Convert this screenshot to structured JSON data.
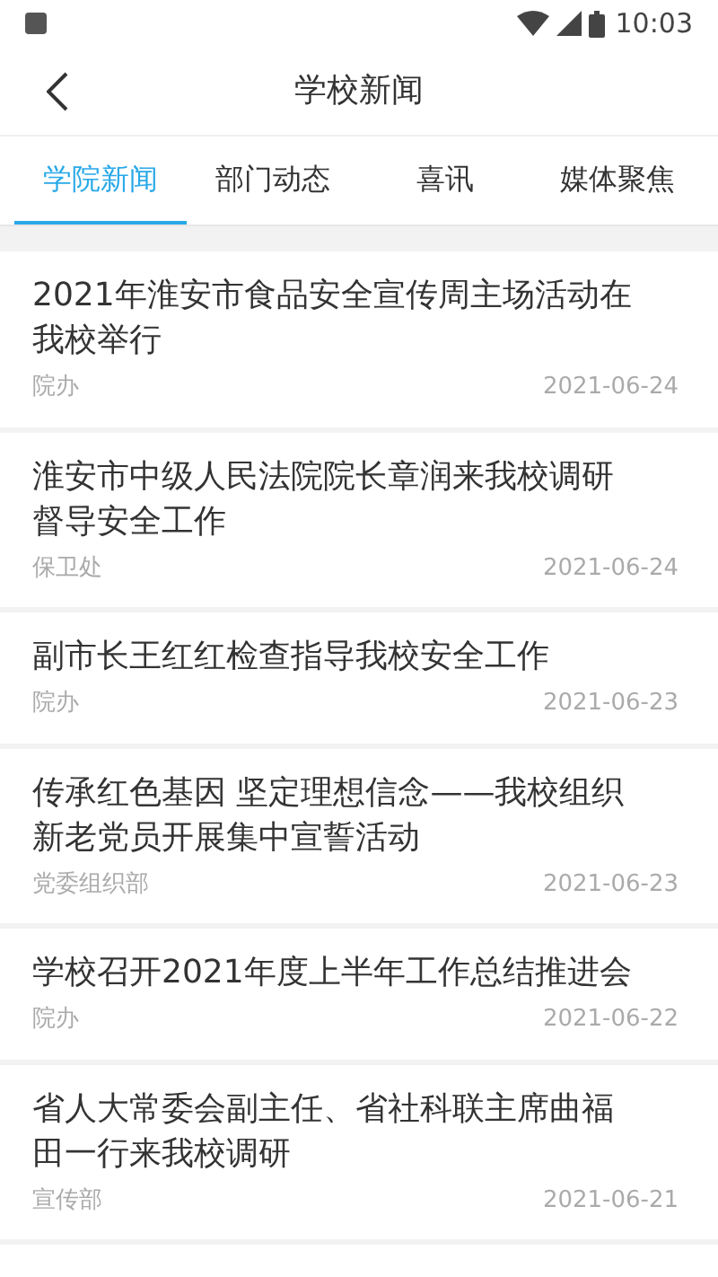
{
  "status_bar": {
    "time": "10:03"
  },
  "header": {
    "title": "学校新闻"
  },
  "tabs": [
    {
      "label": "学院新闻",
      "selected": true
    },
    {
      "label": "部门动态",
      "selected": false
    },
    {
      "label": "喜讯",
      "selected": false
    },
    {
      "label": "媒体聚焦",
      "selected": false
    }
  ],
  "news": [
    {
      "title": "2021年淮安市食品安全宣传周主场活动在我校举行",
      "source": "院办",
      "date": "2021-06-24"
    },
    {
      "title": "淮安市中级人民法院院长章润来我校调研督导安全工作",
      "source": "保卫处",
      "date": "2021-06-24"
    },
    {
      "title": "副市长王红红检查指导我校安全工作",
      "source": "院办",
      "date": "2021-06-23"
    },
    {
      "title": "传承红色基因 坚定理想信念——我校组织新老党员开展集中宣誓活动",
      "source": "党委组织部",
      "date": "2021-06-23"
    },
    {
      "title": "学校召开2021年度上半年工作总结推进会",
      "source": "院办",
      "date": "2021-06-22"
    },
    {
      "title": "省人大常委会副主任、省社科联主席曲福田一行来我校调研",
      "source": "宣传部",
      "date": "2021-06-21"
    }
  ]
}
